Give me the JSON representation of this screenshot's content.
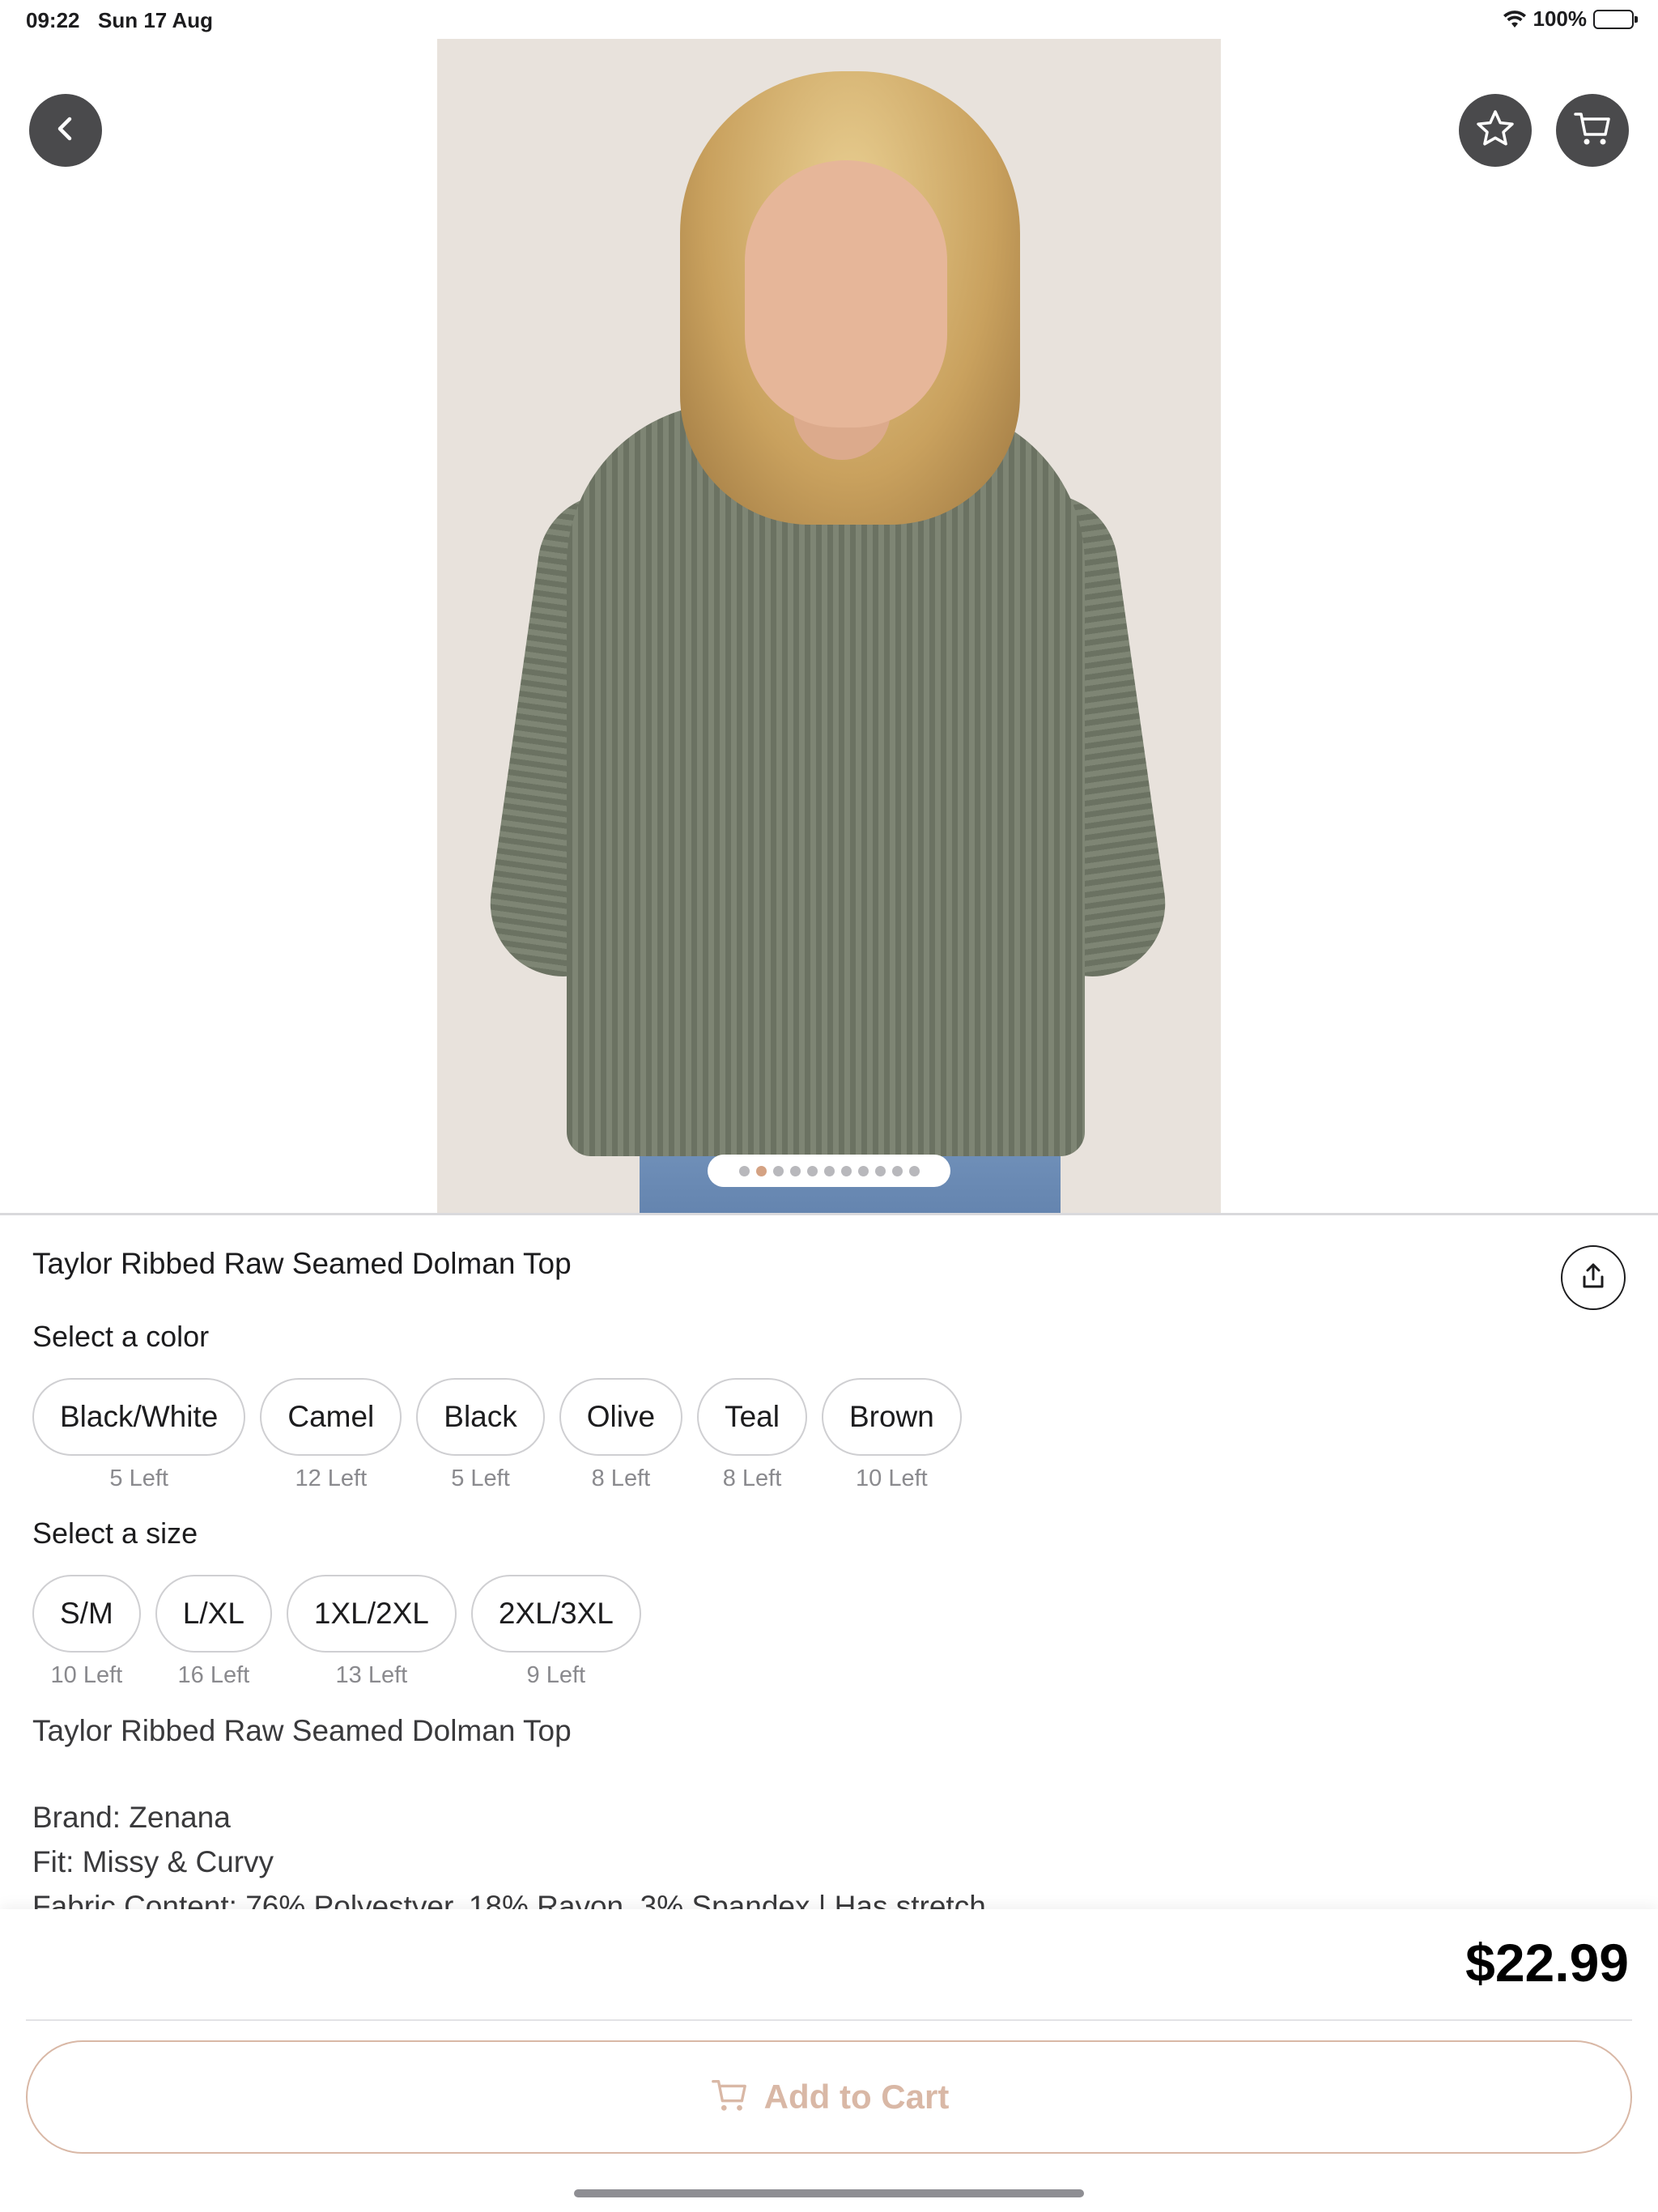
{
  "status_bar": {
    "time": "09:22",
    "date": "Sun 17 Aug",
    "battery": "100%"
  },
  "icons": {
    "back": "chevron-left-icon",
    "favorite": "star-icon",
    "cart": "cart-icon",
    "share": "share-icon",
    "wifi": "wifi-icon",
    "battery": "battery-icon"
  },
  "gallery": {
    "dot_count": 11,
    "active_index": 1
  },
  "product": {
    "title": "Taylor Ribbed Raw Seamed Dolman Top",
    "color_label": "Select a color",
    "colors": [
      {
        "name": "Black/White",
        "stock": "5 Left"
      },
      {
        "name": "Camel",
        "stock": "12 Left"
      },
      {
        "name": "Black",
        "stock": "5 Left"
      },
      {
        "name": "Olive",
        "stock": "8 Left"
      },
      {
        "name": "Teal",
        "stock": "8 Left"
      },
      {
        "name": "Brown",
        "stock": "10 Left"
      }
    ],
    "size_label": "Select a size",
    "sizes": [
      {
        "name": "S/M",
        "stock": "10 Left"
      },
      {
        "name": "L/XL",
        "stock": "16 Left"
      },
      {
        "name": "1XL/2XL",
        "stock": "13 Left"
      },
      {
        "name": "2XL/3XL",
        "stock": "9 Left"
      }
    ],
    "description": {
      "heading": "Taylor Ribbed Raw Seamed Dolman Top",
      "brand": "Brand: Zenana",
      "fit": "Fit: Missy & Curvy",
      "fabric": "Fabric Content: 76% Polyestyer, 18% Rayon, 3% Spandex | Has stretch"
    }
  },
  "checkout": {
    "price": "$22.99",
    "add_to_cart": "Add to Cart"
  },
  "colors_theme": {
    "accent": "#d9b8a6",
    "button_dark": "#4a4a4c",
    "active_dot": "#d4a283"
  }
}
